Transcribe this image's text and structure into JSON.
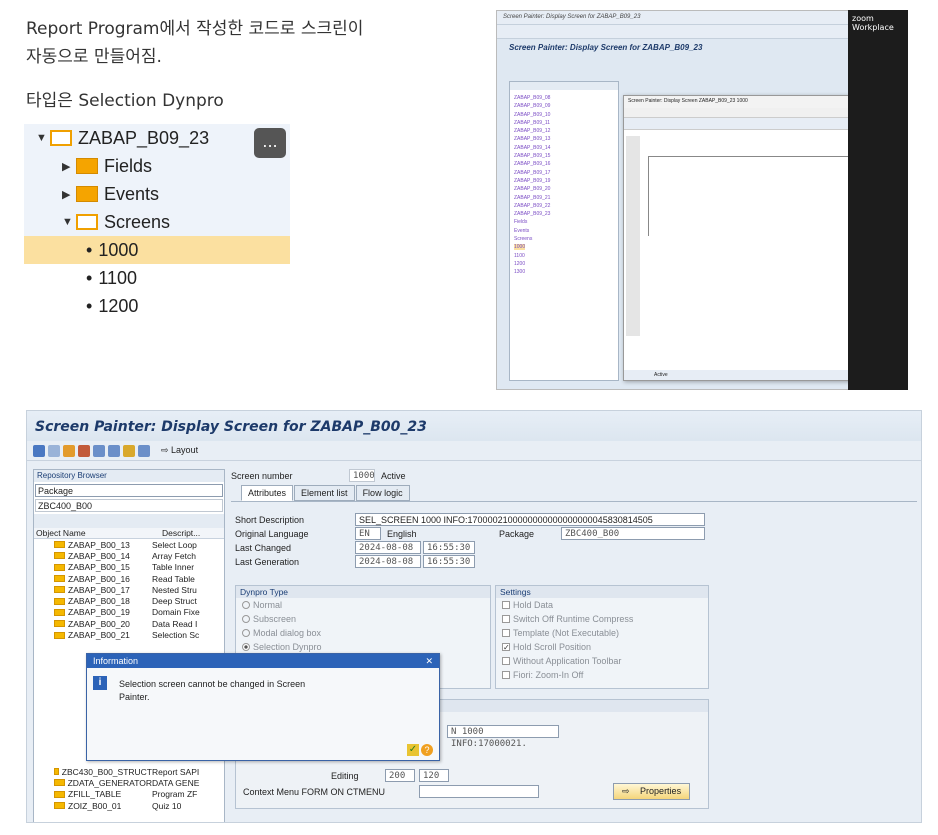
{
  "notes": {
    "line1": "Report Program에서 작성한 코드로 스크린이",
    "line2": "자동으로 만들어짐.",
    "line3": "타입은 Selection Dynpro"
  },
  "tree": {
    "root": "ZABAP_B09_23",
    "fields": "Fields",
    "events": "Events",
    "screens": "Screens",
    "screen_items": [
      "1000",
      "1100",
      "1200",
      "1300"
    ],
    "more": "..."
  },
  "small_screenshot": {
    "title": "Screen Painter: Display Screen for ZABAP_B09_23",
    "zoom": "zoom Workplace",
    "dialog_title": "Screen Painter: Display Screen ZABAP_B09_23 1000",
    "status": "Active"
  },
  "main": {
    "title": "Screen Painter: Display Screen for ZABAP_B00_23",
    "layout_btn": "Layout",
    "repo_browser": "Repository Browser",
    "package_label": "Package",
    "package_value": "ZBC400_B00",
    "col_object": "Object Name",
    "col_desc": "Descript...",
    "tree_rows": [
      {
        "name": "ZABAP_B00_13",
        "desc": "Select Loop"
      },
      {
        "name": "ZABAP_B00_14",
        "desc": "Array Fetch"
      },
      {
        "name": "ZABAP_B00_15",
        "desc": "Table Inner"
      },
      {
        "name": "ZABAP_B00_16",
        "desc": "Read Table"
      },
      {
        "name": "ZABAP_B00_17",
        "desc": "Nested Stru"
      },
      {
        "name": "ZABAP_B00_18",
        "desc": "Deep Struct"
      },
      {
        "name": "ZABAP_B00_19",
        "desc": "Domain Fixe"
      },
      {
        "name": "ZABAP_B00_20",
        "desc": "Data Read I"
      },
      {
        "name": "ZABAP_B00_21",
        "desc": "Selection Sc"
      }
    ],
    "tree_rows_bottom": [
      {
        "name": "ZBC430_B00_STRUCT",
        "desc": "Report SAPI"
      },
      {
        "name": "ZDATA_GENERATOR",
        "desc": "DATA GENE"
      },
      {
        "name": "ZFILL_TABLE",
        "desc": "Program ZF"
      },
      {
        "name": "ZOIZ_B00_01",
        "desc": "Quiz 10"
      }
    ],
    "screen_number_label": "Screen number",
    "screen_number": "1000",
    "screen_status": "Active",
    "tabs": [
      "Attributes",
      "Element list",
      "Flow logic"
    ],
    "short_desc_label": "Short Description",
    "short_desc": "SEL_SCREEN 1000 INFO:1700002100000000000000000045830814505",
    "orig_lang_label": "Original Language",
    "orig_lang_code": "EN",
    "orig_lang": "English",
    "package2_label": "Package",
    "package2": "ZBC400_B00",
    "last_changed_label": "Last Changed",
    "last_changed_date": "2024-08-08",
    "last_changed_time": "16:55:30",
    "last_gen_label": "Last Generation",
    "last_gen_date": "2024-08-08",
    "last_gen_time": "16:55:30",
    "dynpro_type": "Dynpro Type",
    "types": [
      "Normal",
      "Subscreen",
      "Modal dialog box",
      "Selection Dynpro"
    ],
    "settings": "Settings",
    "settings_items": [
      "Hold Data",
      "Switch Off Runtime Compress",
      "Template (Not Executable)",
      "Hold Scroll Position",
      "Without Application Toolbar",
      "Fiori: Zoom-In Off"
    ],
    "other_field": "N 1000 INFO:17000021.",
    "editing_label": "Editing",
    "editing_1": "200",
    "editing_2": "120",
    "context_menu_label": "Context Menu FORM ON CTMENU",
    "properties_btn": "Properties",
    "dialog_title": "Information",
    "dialog_msg1": "Selection screen cannot be changed in Screen",
    "dialog_msg2": "Painter."
  }
}
